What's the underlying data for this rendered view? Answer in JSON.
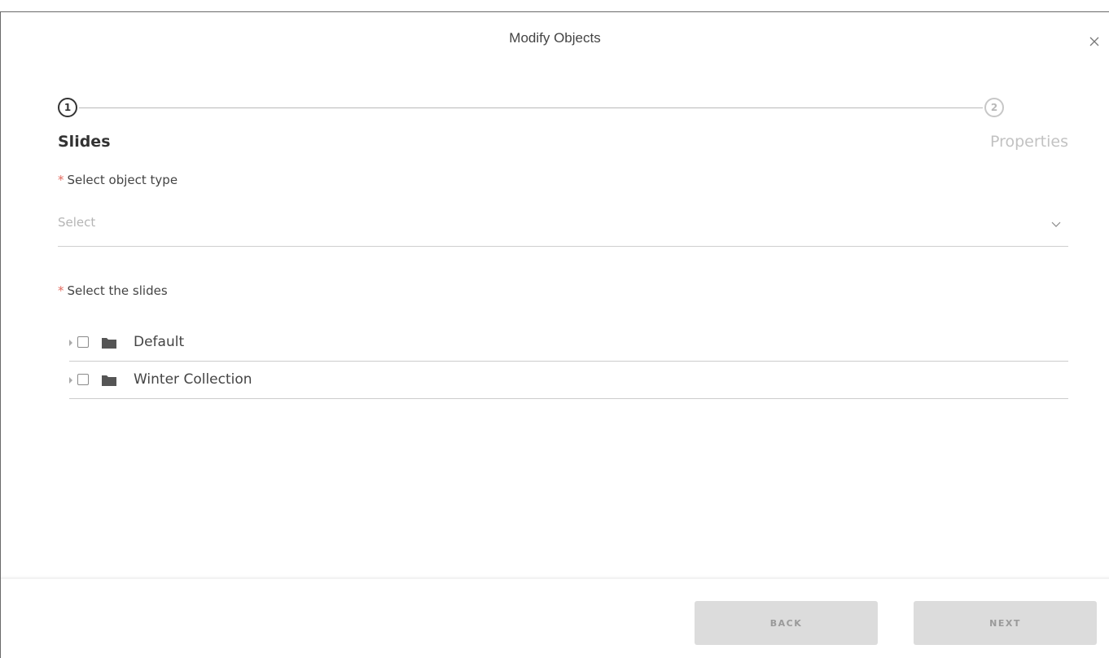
{
  "modal": {
    "title": "Modify Objects"
  },
  "stepper": {
    "steps": [
      {
        "number": "1",
        "label": "Slides",
        "state": "active"
      },
      {
        "number": "2",
        "label": "Properties",
        "state": "inactive"
      }
    ]
  },
  "object_type": {
    "required_mark": "*",
    "label": "Select object type",
    "placeholder": "Select"
  },
  "slides": {
    "required_mark": "*",
    "label": "Select the slides",
    "items": [
      {
        "label": "Default",
        "icon": "folder-icon"
      },
      {
        "label": "Winter Collection",
        "icon": "folder-icon"
      }
    ]
  },
  "footer": {
    "back_label": "BACK",
    "next_label": "NEXT"
  },
  "colors": {
    "required": "#e36a5f",
    "button_disabled_bg": "#dcdcdc",
    "button_disabled_text": "#9a9a9a"
  }
}
